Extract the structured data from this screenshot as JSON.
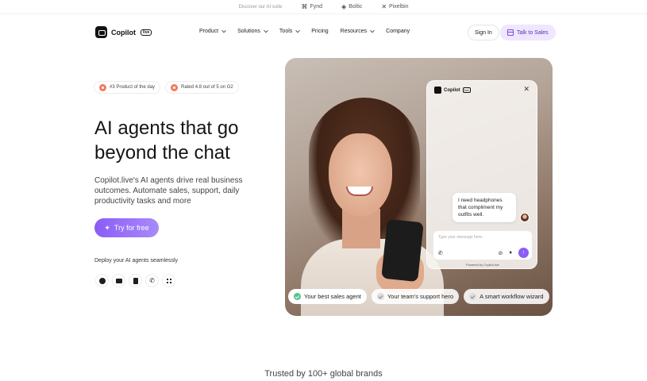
{
  "suite": {
    "discover": "Discover our AI suite",
    "items": [
      {
        "icon": "fynd-icon",
        "label": "Fynd"
      },
      {
        "icon": "boltic-icon",
        "label": "Boltic"
      },
      {
        "icon": "pixelbin-icon",
        "label": "Pixelbin"
      }
    ]
  },
  "nav": {
    "logo_text": "Copilot",
    "logo_badge": "live",
    "menu": [
      "Product",
      "Solutions",
      "Tools",
      "Pricing",
      "Resources",
      "Company"
    ],
    "sign_in": "Sign In",
    "talk_to_sales": "Talk to Sales"
  },
  "hero": {
    "badges": [
      "#3 Product of the day",
      "Rated 4.8 out of 5 on G2"
    ],
    "headline": "AI agents that go beyond the chat",
    "subtext": "Copilot.live's AI agents drive real business outcomes. Automate sales, support, daily productivity tasks and more",
    "cta": "Try for free",
    "deploy_label": "Deploy your AI agents seamlessly",
    "channels": [
      "whatsapp-icon",
      "message-icon",
      "document-icon",
      "phone-icon",
      "slack-icon"
    ]
  },
  "chat": {
    "title": "Copilot",
    "badge": "live",
    "message": "I need headphones that compliment my outfits well.",
    "placeholder": "Type your message here..",
    "powered": "Powered by Copilot.live"
  },
  "pills": [
    {
      "label": "Your best sales agent",
      "active": true
    },
    {
      "label": "Your team's support hero",
      "active": false
    },
    {
      "label": "A smart workflow wizard",
      "active": false
    }
  ],
  "trusted": "Trusted by 100+ global brands",
  "colors": {
    "accent": "#8b5cf6",
    "talk_bg": "#efe6ff",
    "check_on": "#58c08a"
  }
}
